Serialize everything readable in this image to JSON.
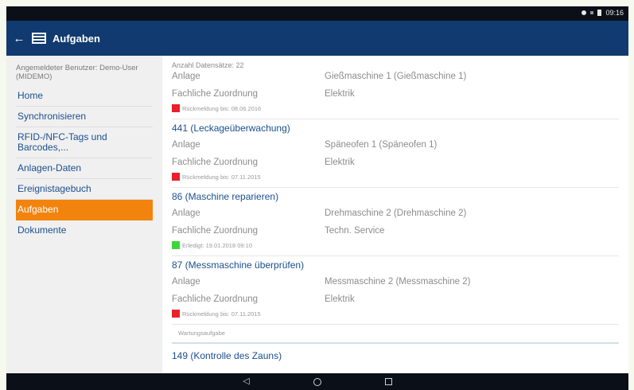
{
  "statusbar": {
    "time": "09:16"
  },
  "appbar": {
    "title": "Aufgaben",
    "back_icon": "←"
  },
  "sidebar": {
    "user": "Angemeldeter Benutzer: Demo-User (MIDEMO)",
    "items": [
      {
        "label": "Home"
      },
      {
        "label": "Synchronisieren"
      },
      {
        "label": "RFID-/NFC-Tags und Barcodes,..."
      },
      {
        "label": "Anlagen-Daten"
      },
      {
        "label": "Ereignistagebuch"
      },
      {
        "label": "Aufgaben",
        "active": true
      },
      {
        "label": "Dokumente"
      }
    ]
  },
  "main": {
    "count": "Anzahl Datensätze: 22",
    "first": {
      "anlage_label": "Anlage",
      "anlage_value": "Gießmaschine 1 (Gießmaschine 1)",
      "zuordnung_label": "Fachliche Zuordnung",
      "zuordnung_value": "Elektrik",
      "status": "Rückmeldung bis: 08.06.2016",
      "status_color": "#e8212a"
    },
    "tasks": [
      {
        "title": "441 (Leckageüberwachung)",
        "anlage_label": "Anlage",
        "anlage_value": "Späneofen 1 (Späneofen 1)",
        "zuordnung_label": "Fachliche Zuordnung",
        "zuordnung_value": "Elektrik",
        "status": "Rückmeldung bis: 07.11.2015",
        "status_color": "#e8212a"
      },
      {
        "title": "86 (Maschine reparieren)",
        "anlage_label": "Anlage",
        "anlage_value": "Drehmaschine 2 (Drehmaschine 2)",
        "zuordnung_label": "Fachliche Zuordnung",
        "zuordnung_value": "Techn. Service",
        "status": "Erledigt: 19.01.2018 09:10",
        "status_color": "#3cd63c"
      },
      {
        "title": "87 (Messmaschine überprüfen)",
        "anlage_label": "Anlage",
        "anlage_value": "Messmaschine 2 (Messmaschine 2)",
        "zuordnung_label": "Fachliche Zuordnung",
        "zuordnung_value": "Elektrik",
        "status": "Rückmeldung bis: 07.11.2015",
        "status_color": "#e8212a"
      }
    ],
    "note": "Wartungsaufgabe",
    "last_title": "149 (Kontrolle des Zauns)"
  },
  "navbar": {
    "back": "◁",
    "home_icon": "home-circle",
    "recent_icon": "recent-square"
  }
}
